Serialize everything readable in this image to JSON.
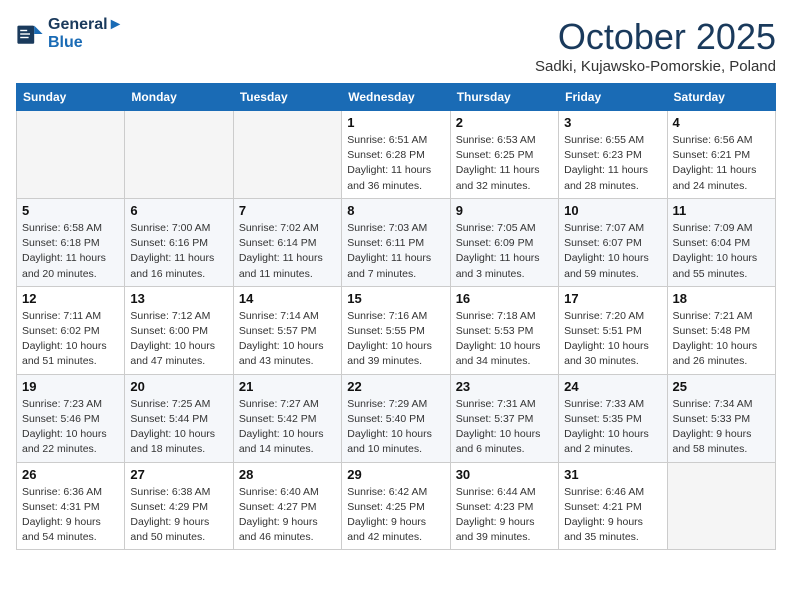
{
  "header": {
    "logo_line1": "General",
    "logo_line2": "Blue",
    "month": "October 2025",
    "location": "Sadki, Kujawsko-Pomorskie, Poland"
  },
  "weekdays": [
    "Sunday",
    "Monday",
    "Tuesday",
    "Wednesday",
    "Thursday",
    "Friday",
    "Saturday"
  ],
  "weeks": [
    [
      {
        "day": "",
        "sunrise": "",
        "sunset": "",
        "daylight": ""
      },
      {
        "day": "",
        "sunrise": "",
        "sunset": "",
        "daylight": ""
      },
      {
        "day": "",
        "sunrise": "",
        "sunset": "",
        "daylight": ""
      },
      {
        "day": "1",
        "sunrise": "Sunrise: 6:51 AM",
        "sunset": "Sunset: 6:28 PM",
        "daylight": "Daylight: 11 hours and 36 minutes."
      },
      {
        "day": "2",
        "sunrise": "Sunrise: 6:53 AM",
        "sunset": "Sunset: 6:25 PM",
        "daylight": "Daylight: 11 hours and 32 minutes."
      },
      {
        "day": "3",
        "sunrise": "Sunrise: 6:55 AM",
        "sunset": "Sunset: 6:23 PM",
        "daylight": "Daylight: 11 hours and 28 minutes."
      },
      {
        "day": "4",
        "sunrise": "Sunrise: 6:56 AM",
        "sunset": "Sunset: 6:21 PM",
        "daylight": "Daylight: 11 hours and 24 minutes."
      }
    ],
    [
      {
        "day": "5",
        "sunrise": "Sunrise: 6:58 AM",
        "sunset": "Sunset: 6:18 PM",
        "daylight": "Daylight: 11 hours and 20 minutes."
      },
      {
        "day": "6",
        "sunrise": "Sunrise: 7:00 AM",
        "sunset": "Sunset: 6:16 PM",
        "daylight": "Daylight: 11 hours and 16 minutes."
      },
      {
        "day": "7",
        "sunrise": "Sunrise: 7:02 AM",
        "sunset": "Sunset: 6:14 PM",
        "daylight": "Daylight: 11 hours and 11 minutes."
      },
      {
        "day": "8",
        "sunrise": "Sunrise: 7:03 AM",
        "sunset": "Sunset: 6:11 PM",
        "daylight": "Daylight: 11 hours and 7 minutes."
      },
      {
        "day": "9",
        "sunrise": "Sunrise: 7:05 AM",
        "sunset": "Sunset: 6:09 PM",
        "daylight": "Daylight: 11 hours and 3 minutes."
      },
      {
        "day": "10",
        "sunrise": "Sunrise: 7:07 AM",
        "sunset": "Sunset: 6:07 PM",
        "daylight": "Daylight: 10 hours and 59 minutes."
      },
      {
        "day": "11",
        "sunrise": "Sunrise: 7:09 AM",
        "sunset": "Sunset: 6:04 PM",
        "daylight": "Daylight: 10 hours and 55 minutes."
      }
    ],
    [
      {
        "day": "12",
        "sunrise": "Sunrise: 7:11 AM",
        "sunset": "Sunset: 6:02 PM",
        "daylight": "Daylight: 10 hours and 51 minutes."
      },
      {
        "day": "13",
        "sunrise": "Sunrise: 7:12 AM",
        "sunset": "Sunset: 6:00 PM",
        "daylight": "Daylight: 10 hours and 47 minutes."
      },
      {
        "day": "14",
        "sunrise": "Sunrise: 7:14 AM",
        "sunset": "Sunset: 5:57 PM",
        "daylight": "Daylight: 10 hours and 43 minutes."
      },
      {
        "day": "15",
        "sunrise": "Sunrise: 7:16 AM",
        "sunset": "Sunset: 5:55 PM",
        "daylight": "Daylight: 10 hours and 39 minutes."
      },
      {
        "day": "16",
        "sunrise": "Sunrise: 7:18 AM",
        "sunset": "Sunset: 5:53 PM",
        "daylight": "Daylight: 10 hours and 34 minutes."
      },
      {
        "day": "17",
        "sunrise": "Sunrise: 7:20 AM",
        "sunset": "Sunset: 5:51 PM",
        "daylight": "Daylight: 10 hours and 30 minutes."
      },
      {
        "day": "18",
        "sunrise": "Sunrise: 7:21 AM",
        "sunset": "Sunset: 5:48 PM",
        "daylight": "Daylight: 10 hours and 26 minutes."
      }
    ],
    [
      {
        "day": "19",
        "sunrise": "Sunrise: 7:23 AM",
        "sunset": "Sunset: 5:46 PM",
        "daylight": "Daylight: 10 hours and 22 minutes."
      },
      {
        "day": "20",
        "sunrise": "Sunrise: 7:25 AM",
        "sunset": "Sunset: 5:44 PM",
        "daylight": "Daylight: 10 hours and 18 minutes."
      },
      {
        "day": "21",
        "sunrise": "Sunrise: 7:27 AM",
        "sunset": "Sunset: 5:42 PM",
        "daylight": "Daylight: 10 hours and 14 minutes."
      },
      {
        "day": "22",
        "sunrise": "Sunrise: 7:29 AM",
        "sunset": "Sunset: 5:40 PM",
        "daylight": "Daylight: 10 hours and 10 minutes."
      },
      {
        "day": "23",
        "sunrise": "Sunrise: 7:31 AM",
        "sunset": "Sunset: 5:37 PM",
        "daylight": "Daylight: 10 hours and 6 minutes."
      },
      {
        "day": "24",
        "sunrise": "Sunrise: 7:33 AM",
        "sunset": "Sunset: 5:35 PM",
        "daylight": "Daylight: 10 hours and 2 minutes."
      },
      {
        "day": "25",
        "sunrise": "Sunrise: 7:34 AM",
        "sunset": "Sunset: 5:33 PM",
        "daylight": "Daylight: 9 hours and 58 minutes."
      }
    ],
    [
      {
        "day": "26",
        "sunrise": "Sunrise: 6:36 AM",
        "sunset": "Sunset: 4:31 PM",
        "daylight": "Daylight: 9 hours and 54 minutes."
      },
      {
        "day": "27",
        "sunrise": "Sunrise: 6:38 AM",
        "sunset": "Sunset: 4:29 PM",
        "daylight": "Daylight: 9 hours and 50 minutes."
      },
      {
        "day": "28",
        "sunrise": "Sunrise: 6:40 AM",
        "sunset": "Sunset: 4:27 PM",
        "daylight": "Daylight: 9 hours and 46 minutes."
      },
      {
        "day": "29",
        "sunrise": "Sunrise: 6:42 AM",
        "sunset": "Sunset: 4:25 PM",
        "daylight": "Daylight: 9 hours and 42 minutes."
      },
      {
        "day": "30",
        "sunrise": "Sunrise: 6:44 AM",
        "sunset": "Sunset: 4:23 PM",
        "daylight": "Daylight: 9 hours and 39 minutes."
      },
      {
        "day": "31",
        "sunrise": "Sunrise: 6:46 AM",
        "sunset": "Sunset: 4:21 PM",
        "daylight": "Daylight: 9 hours and 35 minutes."
      },
      {
        "day": "",
        "sunrise": "",
        "sunset": "",
        "daylight": ""
      }
    ]
  ]
}
